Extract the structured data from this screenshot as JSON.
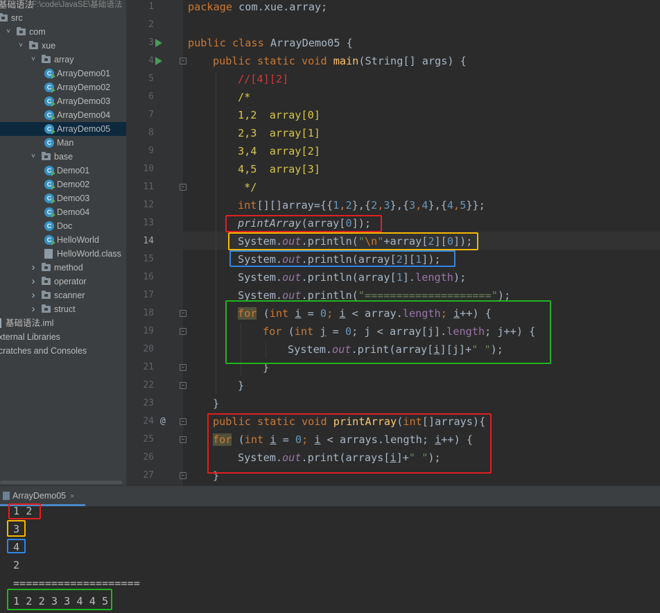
{
  "project_tree": {
    "root_name": "基础语法",
    "root_path": "F:\\code\\JavaSE\\基础语法",
    "items": [
      {
        "label": "src",
        "indent": 0,
        "kind": "folder-plain"
      },
      {
        "label": "com",
        "indent": 1,
        "kind": "folder"
      },
      {
        "label": "xue",
        "indent": 2,
        "kind": "folder",
        "expanded": true
      },
      {
        "label": "array",
        "indent": 3,
        "kind": "folder",
        "expanded": true
      },
      {
        "label": "ArrayDemo01",
        "indent": 4,
        "kind": "class-run"
      },
      {
        "label": "ArrayDemo02",
        "indent": 4,
        "kind": "class-run"
      },
      {
        "label": "ArrayDemo03",
        "indent": 4,
        "kind": "class-run"
      },
      {
        "label": "ArrayDemo04",
        "indent": 4,
        "kind": "class-run"
      },
      {
        "label": "ArrayDemo05",
        "indent": 4,
        "kind": "class-run",
        "selected": true
      },
      {
        "label": "Man",
        "indent": 4,
        "kind": "class"
      },
      {
        "label": "base",
        "indent": 3,
        "kind": "folder",
        "expanded": true
      },
      {
        "label": "Demo01",
        "indent": 4,
        "kind": "class-run"
      },
      {
        "label": "Demo02",
        "indent": 4,
        "kind": "class-run"
      },
      {
        "label": "Demo03",
        "indent": 4,
        "kind": "class-run"
      },
      {
        "label": "Demo04",
        "indent": 4,
        "kind": "class-run"
      },
      {
        "label": "Doc",
        "indent": 4,
        "kind": "class"
      },
      {
        "label": "HelloWorld",
        "indent": 4,
        "kind": "class-run"
      },
      {
        "label": "HelloWorld.class",
        "indent": 4,
        "kind": "classfile"
      },
      {
        "label": "method",
        "indent": 3,
        "kind": "folder",
        "expanded": false
      },
      {
        "label": "operator",
        "indent": 3,
        "kind": "folder",
        "expanded": false
      },
      {
        "label": "scanner",
        "indent": 3,
        "kind": "folder",
        "expanded": false
      },
      {
        "label": "struct",
        "indent": 3,
        "kind": "folder",
        "expanded": false
      },
      {
        "label": "基础语法.iml",
        "indent": 0,
        "kind": "file"
      },
      {
        "label": "xternal Libraries",
        "indent": -1,
        "kind": "none"
      },
      {
        "label": "cratches and Consoles",
        "indent": -1,
        "kind": "none"
      }
    ]
  },
  "editor": {
    "current_line": 14,
    "line_numbers": [
      "1",
      "2",
      "3",
      "4",
      "5",
      "6",
      "7",
      "8",
      "9",
      "10",
      "11",
      "12",
      "13",
      "14",
      "15",
      "16",
      "17",
      "18",
      "19",
      "20",
      "21",
      "22",
      "23",
      "24",
      "25",
      "26",
      "27"
    ],
    "code": {
      "l1_kw": "package",
      "l1_rest": " com.xue.array;",
      "l3_kw": "public class",
      "l3_rest": " ArrayDemo05 {",
      "l4_kw": "public static void",
      "l4_fn": "main",
      "l4_rest": "(String[] args) {",
      "l5": "//[4][2]",
      "l6": "/*",
      "l7": "1,2  array[0]",
      "l8": "2,3  array[1]",
      "l9": "3,4  array[2]",
      "l10": "4,5  array[3]",
      "l11": " */",
      "l12_kw": "int",
      "l12_a": "[][]array={{",
      "l12_n1": "1",
      "l12_c1": ",",
      "l12_n2": "2",
      "l12_b": "},{",
      "l12_n3": "2",
      "l12_c2": ",",
      "l12_n4": "3",
      "l12_c": "},{",
      "l12_n5": "3",
      "l12_c3": ",",
      "l12_n6": "4",
      "l12_d": "},{",
      "l12_n7": "4",
      "l12_c4": ",",
      "l12_n8": "5",
      "l12_e": "}};",
      "l13_fn": "printArray",
      "l13_a": "(array[",
      "l13_n": "0",
      "l13_b": "]);",
      "l14_a": "System.",
      "l14_out": "out",
      "l14_b": ".println(",
      "l14_s1": "\"",
      "l14_esc": "\\n",
      "l14_s2": "\"",
      "l14_c": "+array[",
      "l14_n1": "2",
      "l14_d": "][",
      "l14_n2": "0",
      "l14_e": "]);",
      "l15_a": "System.",
      "l15_out": "out",
      "l15_b": ".println(array[",
      "l15_n1": "2",
      "l15_c": "][",
      "l15_n2": "1",
      "l15_d": "]);",
      "l16_a": "System.",
      "l16_out": "out",
      "l16_b": ".println(array[",
      "l16_n": "1",
      "l16_c": "].",
      "l16_len": "length",
      "l16_d": ");",
      "l17_a": "System.",
      "l17_out": "out",
      "l17_b": ".println(",
      "l17_s": "\"====================\"",
      "l17_c": ");",
      "l18_for": "for",
      "l18_a": " (",
      "l18_int": "int",
      "l18_i": "i",
      "l18_b": " = ",
      "l18_n": "0",
      "l18_c": "; ",
      "l18_i2": "i",
      "l18_d": " < array.",
      "l18_len": "length",
      "l18_e": "; ",
      "l18_i3": "i",
      "l18_f": "++) {",
      "l19_for": "for",
      "l19_a": " (",
      "l19_int": "int",
      "l19_j": "j",
      "l19_b": " = ",
      "l19_n": "0",
      "l19_c": "; j < array[j].",
      "l19_len": "length",
      "l19_d": "; j++) {",
      "l20_a": "System.",
      "l20_out": "out",
      "l20_b": ".print(array[",
      "l20_i": "i",
      "l20_c": "][j]+",
      "l20_s": "\" \"",
      "l20_d": ");",
      "l21": "}",
      "l22": "}",
      "l23": "}",
      "l24_kw": "public static void",
      "l24_fn": "printArray",
      "l24_a": "(",
      "l24_int": "int",
      "l24_b": "[]arrays){",
      "l25_for": "for",
      "l25_a": " (",
      "l25_int": "int",
      "l25_i": "i",
      "l25_b": " = ",
      "l25_n": "0",
      "l25_c": "; ",
      "l25_i2": "i",
      "l25_d": " < arrays.length; ",
      "l25_i3": "i",
      "l25_e": "++) {",
      "l26_a": "System.",
      "l26_out": "out",
      "l26_b": ".print(arrays[",
      "l26_i": "i",
      "l26_c": "]+",
      "l26_s": "\" \"",
      "l26_d": ");",
      "l27": "}"
    }
  },
  "run_panel": {
    "tab_label": "ArrayDemo05",
    "close_symbol": "×",
    "output": [
      "1 2",
      "3",
      "4",
      "2",
      "====================",
      "1 2 2 3 3 4 4 5"
    ]
  },
  "highlight_colors": {
    "red": "#e02020",
    "orange": "#f5b800",
    "blue": "#2f86e8",
    "green": "#1fb51f"
  }
}
